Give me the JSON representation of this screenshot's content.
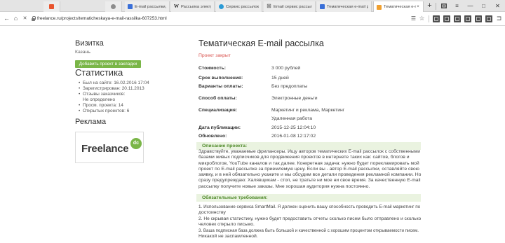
{
  "theme": {
    "accent_green": "#7ab648",
    "status_red": "#d9534f",
    "section_bg": "#eaf3e0",
    "section_text": "#4f8a2a"
  },
  "browser": {
    "pinned_tabs": [
      {
        "icon": "orange-favicon-icon"
      },
      {
        "icon": "gray-favicon-icon"
      }
    ],
    "tabs": [
      {
        "label": "Е-mail рассылки, про",
        "icon": "blue-favicon-icon"
      },
      {
        "label": "Рассылка электронно",
        "icon": "wikipedia-icon"
      },
      {
        "label": "Сервис рассылок. Как",
        "icon": "globe-favicon-icon"
      },
      {
        "label": "Email сервис рассылк",
        "icon": "x-favicon-icon"
      },
      {
        "label": "Тематическая e-mail рассылк",
        "icon": "blue-favicon-icon"
      },
      {
        "label": "Тематическая e-mail рас",
        "icon": "freelance-favicon-icon",
        "active": true
      }
    ],
    "url": "freelance.ru/projects/tematicheskaya-e-mail-rassilka-607253.html"
  },
  "sidebar": {
    "vizitka_title": "Визитка",
    "city": "Казань",
    "bookmark_button": "Добавить проект в закладки",
    "stats_title": "Статистика",
    "stats": [
      {
        "label": "Был на сайте:",
        "value": "16.02.2016 17:04"
      },
      {
        "label": "Зарегистрирован:",
        "value": "20.11.2013"
      },
      {
        "label": "Отзывы заказчиков:",
        "value": "Не определено"
      },
      {
        "label": "Просм. проекта:",
        "value": "14"
      },
      {
        "label": "Открытых проектов:",
        "value": "6"
      }
    ],
    "ads_title": "Реклама",
    "ad": {
      "logo_text": "Freelance",
      "badge_text": "dc"
    }
  },
  "project": {
    "title": "Тематическая E-mail рассылка",
    "status": "Проект закрыт",
    "details": [
      {
        "label": "Стоимость:",
        "value": "3 000 рублей"
      },
      {
        "label": "Срок выполнения:",
        "value": "15 дней"
      },
      {
        "label": "Варианты оплаты:",
        "value": "Без предоплаты"
      },
      {
        "label": "Способ оплаты:",
        "value": "Электронные деньги"
      },
      {
        "label": "Специализация:",
        "value": "Маркетинг и реклама, Маркетинг",
        "value2": "Удаленная работа"
      },
      {
        "label": "Дата публикации:",
        "value": "2015-12-25 12:04:10"
      },
      {
        "label": "Обновлено:",
        "value": "2016-01-08 12:17:02"
      }
    ],
    "description_title": "Описание проекта:",
    "description_lines": [
      "Здравствуйте, уважаемые фрилансеры. Ищу авторов тематических E-mail рассылок с собственными",
      "базами живых подписчиков для продвижения проектов в интернете таких как: сайтов, блогов и",
      "микроблогов, YouTube каналов и так далее. Конкретная задача: нужно будет порекламировать мой",
      "проект по E-mail рассылке за приемлемую цену. Если вы - автор E-mail рассылки, оставляйте свою",
      "заявку, и в ней обязательно укажите и мы обсудим все детали проведения рекламной компании. Но",
      "сразу предупреждаю: Халявщикам - стоп, не тратьте ни мое ни свое время. За качественную E-mail",
      "рассылку получите новые заказы. Мне хорошая аудитория нужна постоянно."
    ],
    "requirements_title": "Обязательные требования:",
    "requirements_lines": [
      "1. Использование сервиса SmartMail. Я должен оценить вашу способность проводить E-mail маркетинг по",
      "достоинству",
      "2. Не скрывая статистику, нужно будет предоставить отчеты сколько писем было отправлено и сколько",
      "человек открыло письмо.",
      "3. Ваша подписная база должна быть большой и качественной с хорошим процентом открываемости писем.",
      "Никакой не заспамленной."
    ]
  }
}
